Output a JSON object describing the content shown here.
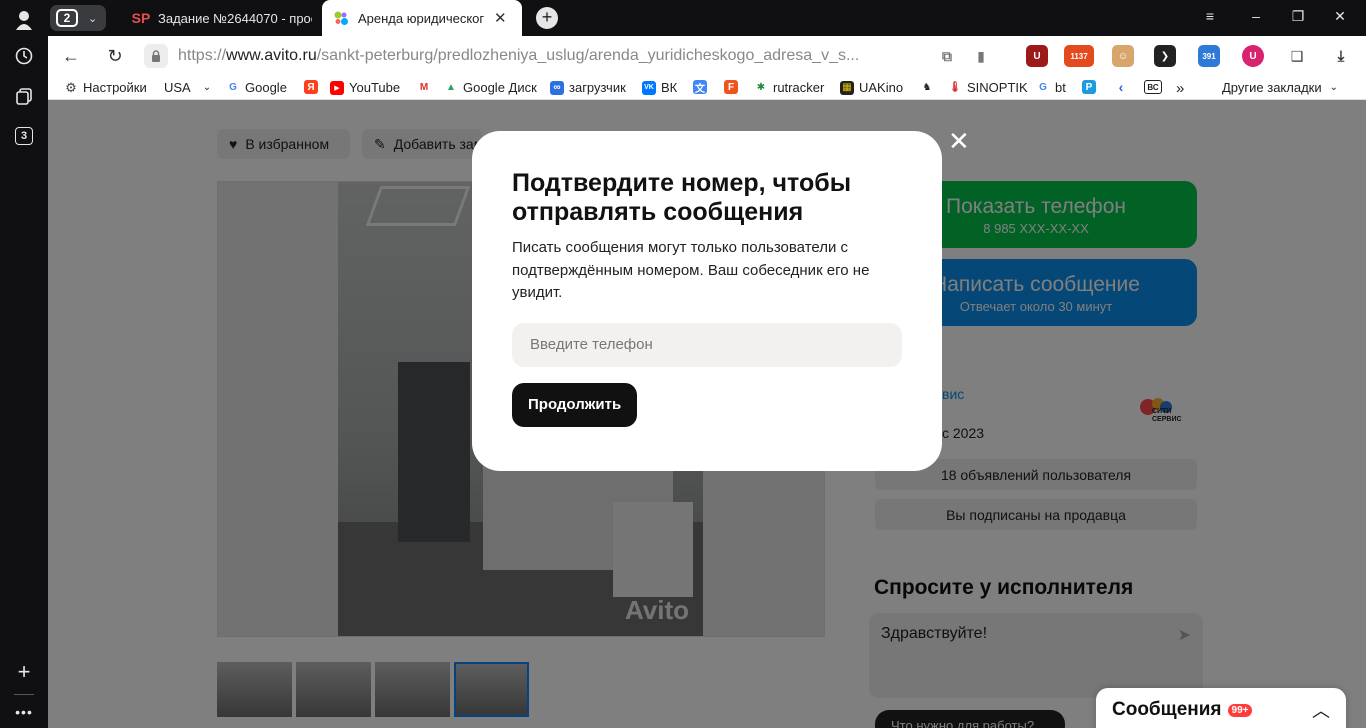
{
  "rail": {
    "tabs_badge": "3"
  },
  "tabs": {
    "count": "2",
    "items": [
      {
        "favicon": "SP",
        "title": "Задание №2644070 - прое"
      },
      {
        "favicon": "avito-logo",
        "title": "Аренда юридического"
      }
    ]
  },
  "addressbar": {
    "url_prefix": "https://",
    "url_domain": "www.avito.ru",
    "url_path": "/sankt-peterburg/predlozheniya_uslug/arenda_yuridicheskogo_adresa_v_s..."
  },
  "extensions": [
    "translate-icon",
    "bookmark-icon",
    "ublock-icon",
    "counter-icon",
    "grabber-icon",
    "dark-reader-icon",
    "calendar-icon",
    "u-shield-icon",
    "sidebar-icon",
    "download-icon"
  ],
  "ext_labels": {
    "counter": "1137",
    "calendar": "391"
  },
  "bookmarks": [
    {
      "label": "Настройки",
      "icon": "gear-icon"
    },
    {
      "label": "USA",
      "icon": ""
    },
    {
      "label": "Google",
      "icon": "G"
    },
    {
      "label": "",
      "icon": "Я"
    },
    {
      "label": "YouTube",
      "icon": "▶"
    },
    {
      "label": "",
      "icon": "M"
    },
    {
      "label": "Google Диск",
      "icon": "▲"
    },
    {
      "label": "загрузчик",
      "icon": "∞"
    },
    {
      "label": "ВК",
      "icon": "VK"
    },
    {
      "label": "",
      "icon": "文"
    },
    {
      "label": "",
      "icon": "F"
    },
    {
      "label": "rutracker",
      "icon": "✱"
    },
    {
      "label": "UAKino",
      "icon": "▦"
    },
    {
      "label": "",
      "icon": "♞"
    },
    {
      "label": "SINOPTIK",
      "icon": "🌡"
    },
    {
      "label": "bt",
      "icon": "G"
    },
    {
      "label": "",
      "icon": "P"
    },
    {
      "label": "",
      "icon": "‹"
    },
    {
      "label": "",
      "icon": "ВС"
    }
  ],
  "bookmarks_more": "»",
  "bookmarks_other": "Другие закладки",
  "page": {
    "favorites_label": "В избранном",
    "add_note_label": "Добавить зам",
    "watermark": "Avito",
    "show_phone": {
      "title": "Показать телефон",
      "sub": "8 985 XXX-XX-XX"
    },
    "write_message": {
      "title": "Написать сообщение",
      "sub": "Отвечает около 30 минут"
    },
    "seller_fragment": "вис",
    "since_fragment": "с 2023",
    "seller_logo": "СИТИ СЕРВИС",
    "listings_button": "18 объявлений пользователя",
    "subscribed_button": "Вы подписаны на продавца",
    "ask_title": "Спросите у исполнителя",
    "chat_text": "Здравствуйте!",
    "question_pill": "Что нужно для работы?",
    "messages": {
      "title": "Сообщения",
      "badge": "99+"
    }
  },
  "modal": {
    "title": "Подтвердите номер, чтобы отправлять сообщения",
    "text": "Писать сообщения могут только пользователи с подтверждённым номером. Ваш собеседник его не увидит.",
    "phone_placeholder": "Введите телефон",
    "continue_label": "Продолжить"
  },
  "colors": {
    "green": "#04c44c",
    "blue": "#0a8fec",
    "overlay": "rgba(0,0,0,0.5)"
  }
}
